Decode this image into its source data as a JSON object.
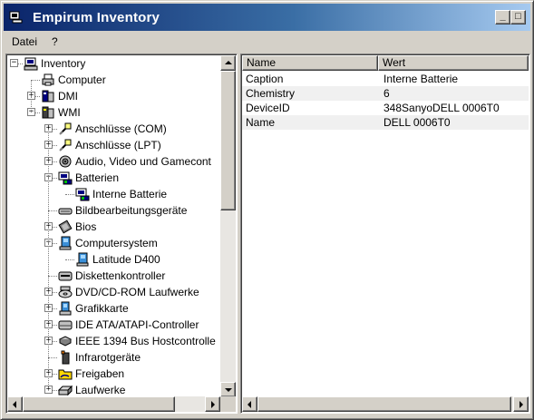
{
  "window": {
    "title": "Empirum Inventory"
  },
  "titlebar_buttons": {
    "minimize": "_",
    "maximize": "□"
  },
  "menu": [
    {
      "label": "Datei"
    },
    {
      "label": "?"
    }
  ],
  "tree": {
    "expander_collapsed": "+",
    "expander_expanded": "−",
    "items": [
      {
        "label": "Inventory",
        "icon": "computer-network-icon",
        "level": 0,
        "expander": "expanded"
      },
      {
        "label": "Computer",
        "icon": "printer-icon",
        "level": 1,
        "expander": "none"
      },
      {
        "label": "DMI",
        "icon": "dmi-icon",
        "level": 1,
        "expander": "collapsed"
      },
      {
        "label": "WMI",
        "icon": "wmi-icon",
        "level": 1,
        "expander": "expanded"
      },
      {
        "label": "Anschlüsse (COM)",
        "icon": "plug-icon",
        "level": 2,
        "expander": "collapsed"
      },
      {
        "label": "Anschlüsse (LPT)",
        "icon": "plug-icon",
        "level": 2,
        "expander": "collapsed"
      },
      {
        "label": "Audio, Video und Gamecont",
        "icon": "speaker-icon",
        "level": 2,
        "expander": "collapsed"
      },
      {
        "label": "Batterien",
        "icon": "battery-icon",
        "level": 2,
        "expander": "expanded"
      },
      {
        "label": "Interne Batterie",
        "icon": "battery-icon",
        "level": 3,
        "expander": "none"
      },
      {
        "label": "Bildbearbeitungsgeräte",
        "icon": "scanner-icon",
        "level": 2,
        "expander": "none"
      },
      {
        "label": "Bios",
        "icon": "chip-icon",
        "level": 2,
        "expander": "collapsed"
      },
      {
        "label": "Computersystem",
        "icon": "computer-system-icon",
        "level": 2,
        "expander": "expanded"
      },
      {
        "label": "Latitude D400",
        "icon": "computer-system-icon",
        "level": 3,
        "expander": "none"
      },
      {
        "label": "Diskettenkontroller",
        "icon": "floppy-controller-icon",
        "level": 2,
        "expander": "none"
      },
      {
        "label": "DVD/CD-ROM Laufwerke",
        "icon": "cdrom-icon",
        "level": 2,
        "expander": "collapsed"
      },
      {
        "label": "Grafikkarte",
        "icon": "graphics-card-icon",
        "level": 2,
        "expander": "collapsed"
      },
      {
        "label": "IDE ATA/ATAPI-Controller",
        "icon": "ide-controller-icon",
        "level": 2,
        "expander": "collapsed"
      },
      {
        "label": "IEEE 1394 Bus Hostcontrolle",
        "icon": "ieee1394-icon",
        "level": 2,
        "expander": "collapsed"
      },
      {
        "label": "Infrarotgeräte",
        "icon": "infrared-icon",
        "level": 2,
        "expander": "none"
      },
      {
        "label": "Freigaben",
        "icon": "shared-folder-icon",
        "level": 2,
        "expander": "collapsed"
      },
      {
        "label": "Laufwerke",
        "icon": "drive-icon",
        "level": 2,
        "expander": "collapsed"
      }
    ]
  },
  "listview": {
    "columns": [
      {
        "label": "Name"
      },
      {
        "label": "Wert"
      }
    ],
    "rows": [
      {
        "name": "Caption",
        "value": "Interne Batterie"
      },
      {
        "name": "Chemistry",
        "value": "6"
      },
      {
        "name": "DeviceID",
        "value": "348SanyoDELL 0006T0"
      },
      {
        "name": "Name",
        "value": "DELL 0006T0"
      }
    ]
  },
  "colors": {
    "titlebar_start": "#0a246a",
    "titlebar_end": "#a6caf0",
    "face": "#d4d0c8",
    "alt_row": "#f0f0f0"
  }
}
